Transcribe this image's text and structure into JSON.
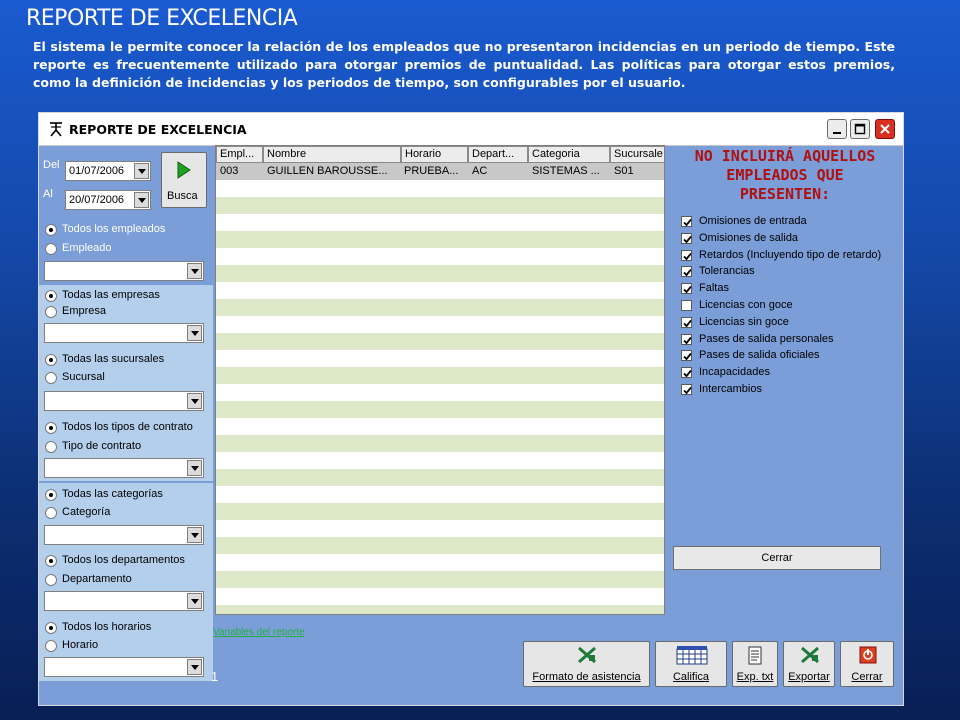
{
  "slide": {
    "title": "REPORTE DE EXCELENCIA",
    "description": "El sistema le permite conocer la relación de los empleados que no presentaron incidencias en un periodo de tiempo. Este reporte es frecuentemente utilizado para otorgar premios de puntualidad. Las políticas para otorgar estos premios, como la definición de incidencias y los periodos de tiempo, son configurables por el usuario."
  },
  "window": {
    "title": "REPORTE DE EXCELENCIA",
    "icon": "stickman-icon"
  },
  "dates": {
    "from_label": "Del",
    "from_value": "01/07/2006",
    "to_label": "Al",
    "to_value": "20/07/2006",
    "search_button": "Busca"
  },
  "filters": [
    {
      "all": "Todos los empleados",
      "specific": "Empleado"
    },
    {
      "all": "Todas las empresas",
      "specific": "Empresa"
    },
    {
      "all": "Todas las sucursales",
      "specific": "Sucursal"
    },
    {
      "all": "Todos los tipos de contrato",
      "specific": "Tipo de contrato"
    },
    {
      "all": "Todas las categorías",
      "specific": "Categoría"
    },
    {
      "all": "Todos los departamentos",
      "specific": "Departamento"
    },
    {
      "all": "Todos los horarios",
      "specific": "Horario"
    }
  ],
  "grid": {
    "columns": [
      "Empl...",
      "Nombre",
      "Horario",
      "Depart...",
      "Categoria",
      "Sucursale"
    ],
    "rows": [
      [
        "003",
        "GUILLEN BAROUSSE...",
        "PRUEBA...",
        "AC",
        "SISTEMAS ...",
        "S01"
      ]
    ]
  },
  "exclusions": {
    "title_lines": [
      "NO INCLUIRÁ AQUELLOS",
      "EMPLEADOS QUE",
      "PRESENTEN:"
    ],
    "items": [
      {
        "label": "Omisiones de entrada",
        "checked": true
      },
      {
        "label": "Omisiones de salida",
        "checked": true
      },
      {
        "label": "Retardos (Incluyendo tipo de retardo)",
        "checked": true
      },
      {
        "label": "Tolerancias",
        "checked": true
      },
      {
        "label": "Faltas",
        "checked": true
      },
      {
        "label": "Licencias con goce",
        "checked": false
      },
      {
        "label": "Licencias sin goce",
        "checked": true
      },
      {
        "label": "Pases de salida personales",
        "checked": true
      },
      {
        "label": "Pases de salida oficiales",
        "checked": true
      },
      {
        "label": "Incapacidades",
        "checked": true
      },
      {
        "label": "Intercambios",
        "checked": true
      }
    ],
    "close_button": "Cerrar"
  },
  "footer": {
    "link_text": "Variables del reporte",
    "count": "1",
    "buttons": {
      "format": "Formato de asistencia",
      "grade": "Califica",
      "export_txt": "Exp. txt",
      "export": "Exportar",
      "close": "Cerrar"
    }
  },
  "colors": {
    "excel_green": "#1d7a3a",
    "exclusion_title": "#b01010",
    "row_stripe": "#dde8c8"
  }
}
